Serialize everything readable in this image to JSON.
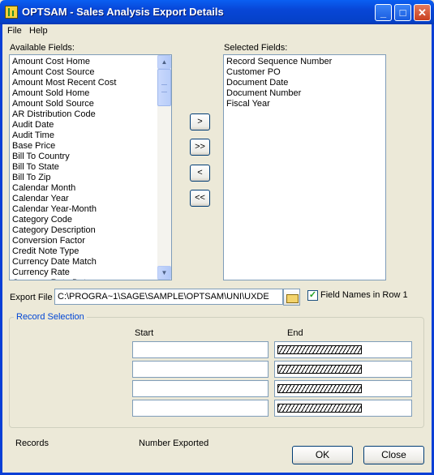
{
  "window": {
    "title": "OPTSAM - Sales Analysis Export Details",
    "icon": "app-icon"
  },
  "titlebar_buttons": {
    "minimize": "_",
    "maximize": "□",
    "close": "✕"
  },
  "menu": {
    "file": "File",
    "help": "Help"
  },
  "available_fields": {
    "label": "Available Fields:",
    "items": [
      "Amount Cost Home",
      "Amount Cost Source",
      "Amount Most Recent Cost",
      "Amount Sold Home",
      "Amount Sold Source",
      "AR Distribution Code",
      "Audit Date",
      "Audit Time",
      "Base Price",
      "Bill To Country",
      "Bill To State",
      "Bill To Zip",
      "Calendar Month",
      "Calendar Year",
      "Calendar Year-Month",
      "Category Code",
      "Category Description",
      "Conversion Factor",
      "Credit Note Type",
      "Currency Date Match",
      "Currency Rate",
      "Currency Rate Date"
    ]
  },
  "selected_fields": {
    "label": "Selected Fields:",
    "items": [
      "Record Sequence Number",
      "Customer PO",
      "Document Date",
      "Document Number",
      "Fiscal Year"
    ]
  },
  "move_buttons": {
    "add": ">",
    "add_all": ">>",
    "remove": "<",
    "remove_all": "<<"
  },
  "export": {
    "label": "Export File",
    "path": "C:\\PROGRA~1\\SAGE\\SAMPLE\\OPTSAM\\UNI\\UXDE",
    "field_names_label": "Field Names in Row 1",
    "field_names_checked": true
  },
  "record_selection": {
    "title": "Record Selection",
    "start_label": "Start",
    "end_label": "End"
  },
  "footer": {
    "records_label": "Records",
    "number_exported_label": "Number Exported",
    "ok": "OK",
    "close": "Close"
  }
}
